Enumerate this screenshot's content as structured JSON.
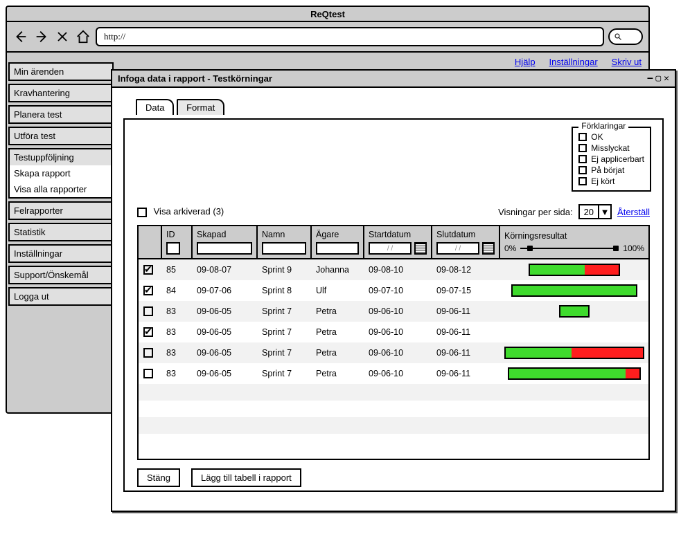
{
  "app_title": "ReQtest",
  "url_value": "http://",
  "top_links": [
    "Hjälp",
    "Inställningar",
    "Skriv ut"
  ],
  "nav": {
    "groups": [
      [
        "Min ärenden"
      ],
      [
        "Kravhantering"
      ],
      [
        "Planera test"
      ],
      [
        "Utföra test"
      ],
      [
        "Testuppföljning",
        "Skapa rapport",
        "Visa alla rapporter"
      ],
      [
        "Felrapporter"
      ],
      [
        "Statistik"
      ],
      [
        "Inställningar"
      ],
      [
        "Support/Önskemål"
      ],
      [
        "Logga ut"
      ]
    ],
    "active": "Skapa rapport"
  },
  "modal": {
    "title": "Infoga data i rapport - Testkörningar",
    "tabs": {
      "data": "Data",
      "format": "Format"
    },
    "legend": {
      "title": "Förklaringar",
      "items": [
        "OK",
        "Misslyckat",
        "Ej applicerbart",
        "På börjat",
        "Ej kört"
      ]
    },
    "show_archived_label": "Visa arkiverad (3)",
    "per_page_label": "Visningar per sida:",
    "per_page_value": "20",
    "reset_label": "Återställ",
    "columns": {
      "id": "ID",
      "skapad": "Skapad",
      "namn": "Namn",
      "agare": "Ägare",
      "start": "Startdatum",
      "slut": "Slutdatum",
      "res": "Körningsresultat"
    },
    "res_low": "0%",
    "res_high": "100%",
    "date_filter_placeholder": "/  /",
    "rows": [
      {
        "checked": true,
        "id": "85",
        "skapad": "09-08-07",
        "namn": "Sprint 9",
        "agare": "Johanna",
        "start": "09-08-10",
        "slut": "09-08-12",
        "green": 40,
        "red": 25,
        "gap": 0
      },
      {
        "checked": true,
        "id": "84",
        "skapad": "09-07-06",
        "namn": "Sprint 8",
        "agare": "Ulf",
        "start": "09-07-10",
        "slut": "09-07-15",
        "green": 90,
        "red": 0,
        "gap": 0
      },
      {
        "checked": false,
        "id": "83",
        "skapad": "09-06-05",
        "namn": "Sprint 7",
        "agare": "Petra",
        "start": "09-06-10",
        "slut": "09-06-11",
        "green": 22,
        "red": 0,
        "gap": 0
      },
      {
        "checked": true,
        "id": "83",
        "skapad": "09-06-05",
        "namn": "Sprint 7",
        "agare": "Petra",
        "start": "09-06-10",
        "slut": "09-06-11",
        "green": 0,
        "red": 0,
        "gap": 0
      },
      {
        "checked": false,
        "id": "83",
        "skapad": "09-06-05",
        "namn": "Sprint 7",
        "agare": "Petra",
        "start": "09-06-10",
        "slut": "09-06-11",
        "green": 48,
        "red": 52,
        "gap": 0
      },
      {
        "checked": false,
        "id": "83",
        "skapad": "09-06-05",
        "namn": "Sprint 7",
        "agare": "Petra",
        "start": "09-06-10",
        "slut": "09-06-11",
        "green": 85,
        "red": 10,
        "gap": 0
      }
    ],
    "close_btn": "Stäng",
    "add_btn": "Lägg till tabell i rapport"
  }
}
